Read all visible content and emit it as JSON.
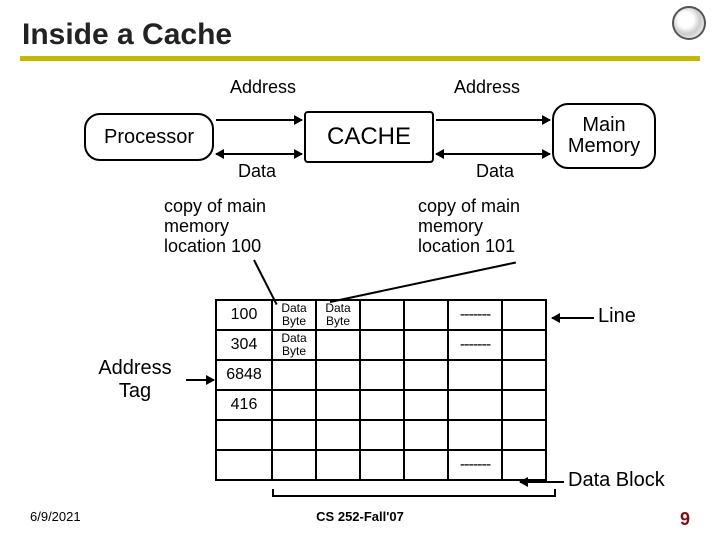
{
  "title": "Inside a Cache",
  "nodes": {
    "processor": "Processor",
    "cache": "CACHE",
    "memory": "Main Memory"
  },
  "bus": {
    "addr_left": "Address",
    "addr_right": "Address",
    "data_left": "Data",
    "data_right": "Data"
  },
  "captions": {
    "loc100": "copy of main\nmemory\nlocation 100",
    "loc101": "copy of main\nmemory\nlocation 101"
  },
  "table": {
    "tags": [
      "100",
      "304",
      "6848",
      "416"
    ],
    "hdr": {
      "db": "Data Byte"
    },
    "dash": "-------"
  },
  "labels": {
    "addr_tag": "Address Tag",
    "line": "Line",
    "data_block": "Data Block"
  },
  "footer": {
    "date": "6/9/2021",
    "course": "CS 252-Fall'07",
    "page": "9"
  }
}
